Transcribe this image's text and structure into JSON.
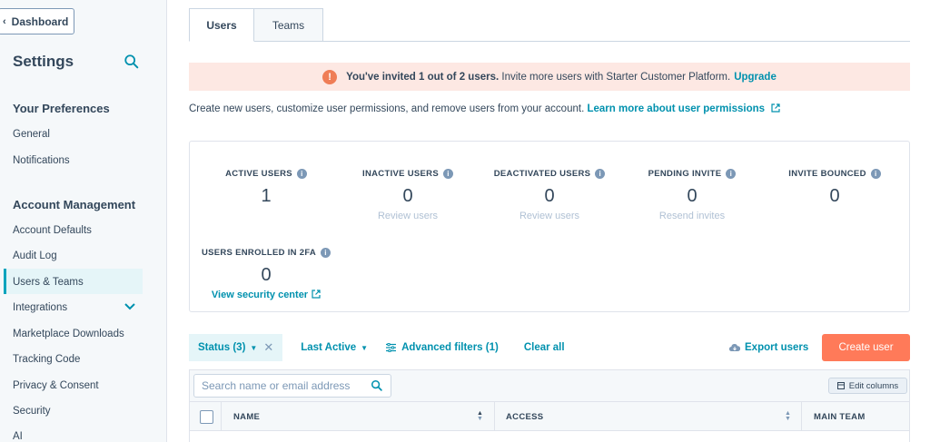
{
  "sidebar": {
    "dashboard_label": "Dashboard",
    "title": "Settings",
    "sections": [
      {
        "heading": "Your Preferences",
        "items": [
          "General",
          "Notifications"
        ]
      },
      {
        "heading": "Account Management",
        "items": [
          "Account Defaults",
          "Audit Log",
          "Users & Teams",
          "Integrations",
          "Marketplace Downloads",
          "Tracking Code",
          "Privacy & Consent",
          "Security",
          "AI"
        ]
      }
    ],
    "active_item": "Users & Teams"
  },
  "tabs": [
    {
      "label": "Users",
      "active": true
    },
    {
      "label": "Teams",
      "active": false
    }
  ],
  "banner": {
    "icon": "!",
    "bold_text": "You've invited 1 out of 2 users.",
    "text": "Invite more users with Starter Customer Platform.",
    "link": "Upgrade"
  },
  "description": {
    "text": "Create new users, customize user permissions, and remove users from your account.",
    "link": "Learn more about user permissions"
  },
  "stats": [
    {
      "label": "ACTIVE USERS",
      "value": "1",
      "link": ""
    },
    {
      "label": "INACTIVE USERS",
      "value": "0",
      "link": "Review users"
    },
    {
      "label": "DEACTIVATED USERS",
      "value": "0",
      "link": "Review users"
    },
    {
      "label": "PENDING INVITE",
      "value": "0",
      "link": "Resend invites"
    },
    {
      "label": "INVITE BOUNCED",
      "value": "0",
      "link": ""
    },
    {
      "label": "USERS ENROLLED IN 2FA",
      "value": "0",
      "link": "View security center"
    }
  ],
  "filters": {
    "status": "Status (3)",
    "last_active": "Last Active",
    "advanced": "Advanced filters (1)",
    "clear": "Clear all",
    "export": "Export users",
    "create": "Create user"
  },
  "table": {
    "search_placeholder": "Search name or email address",
    "edit_columns": "Edit columns",
    "columns": [
      "NAME",
      "ACCESS",
      "MAIN TEAM"
    ]
  },
  "colors": {
    "accent": "#0091ae",
    "primary_button": "#ff7a59",
    "banner_bg": "#fde8e3",
    "active_nav_bg": "#e5f5f8"
  }
}
